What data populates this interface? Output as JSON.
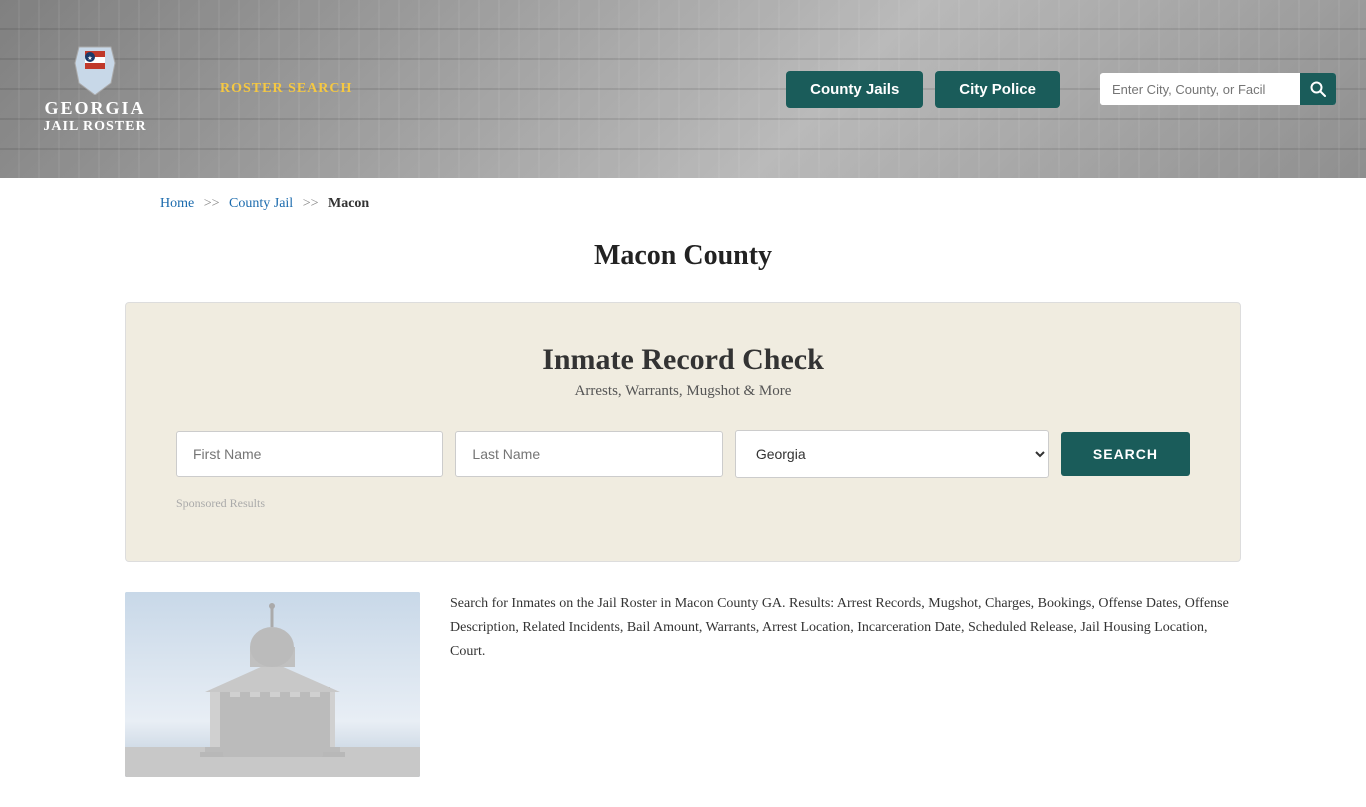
{
  "header": {
    "logo": {
      "georgia": "GEORGIA",
      "jail_roster": "JAIL ROSTER"
    },
    "nav_link": "ROSTER SEARCH",
    "county_jails_btn": "County Jails",
    "city_police_btn": "City Police",
    "search_placeholder": "Enter City, County, or Facil"
  },
  "breadcrumb": {
    "home": "Home",
    "sep1": ">>",
    "county_jail": "County Jail",
    "sep2": ">>",
    "current": "Macon"
  },
  "page_title": "Macon County",
  "record_check": {
    "title": "Inmate Record Check",
    "subtitle": "Arrests, Warrants, Mugshot & More",
    "first_name_placeholder": "First Name",
    "last_name_placeholder": "Last Name",
    "state_default": "Georgia",
    "search_btn": "SEARCH",
    "sponsored_label": "Sponsored Results"
  },
  "bottom": {
    "description": "Search for Inmates on the Jail Roster in Macon County GA. Results: Arrest Records, Mugshot, Charges, Bookings, Offense Dates, Offense Description, Related Incidents, Bail Amount, Warrants, Arrest Location, Incarceration Date, Scheduled Release, Jail Housing Location, Court."
  }
}
